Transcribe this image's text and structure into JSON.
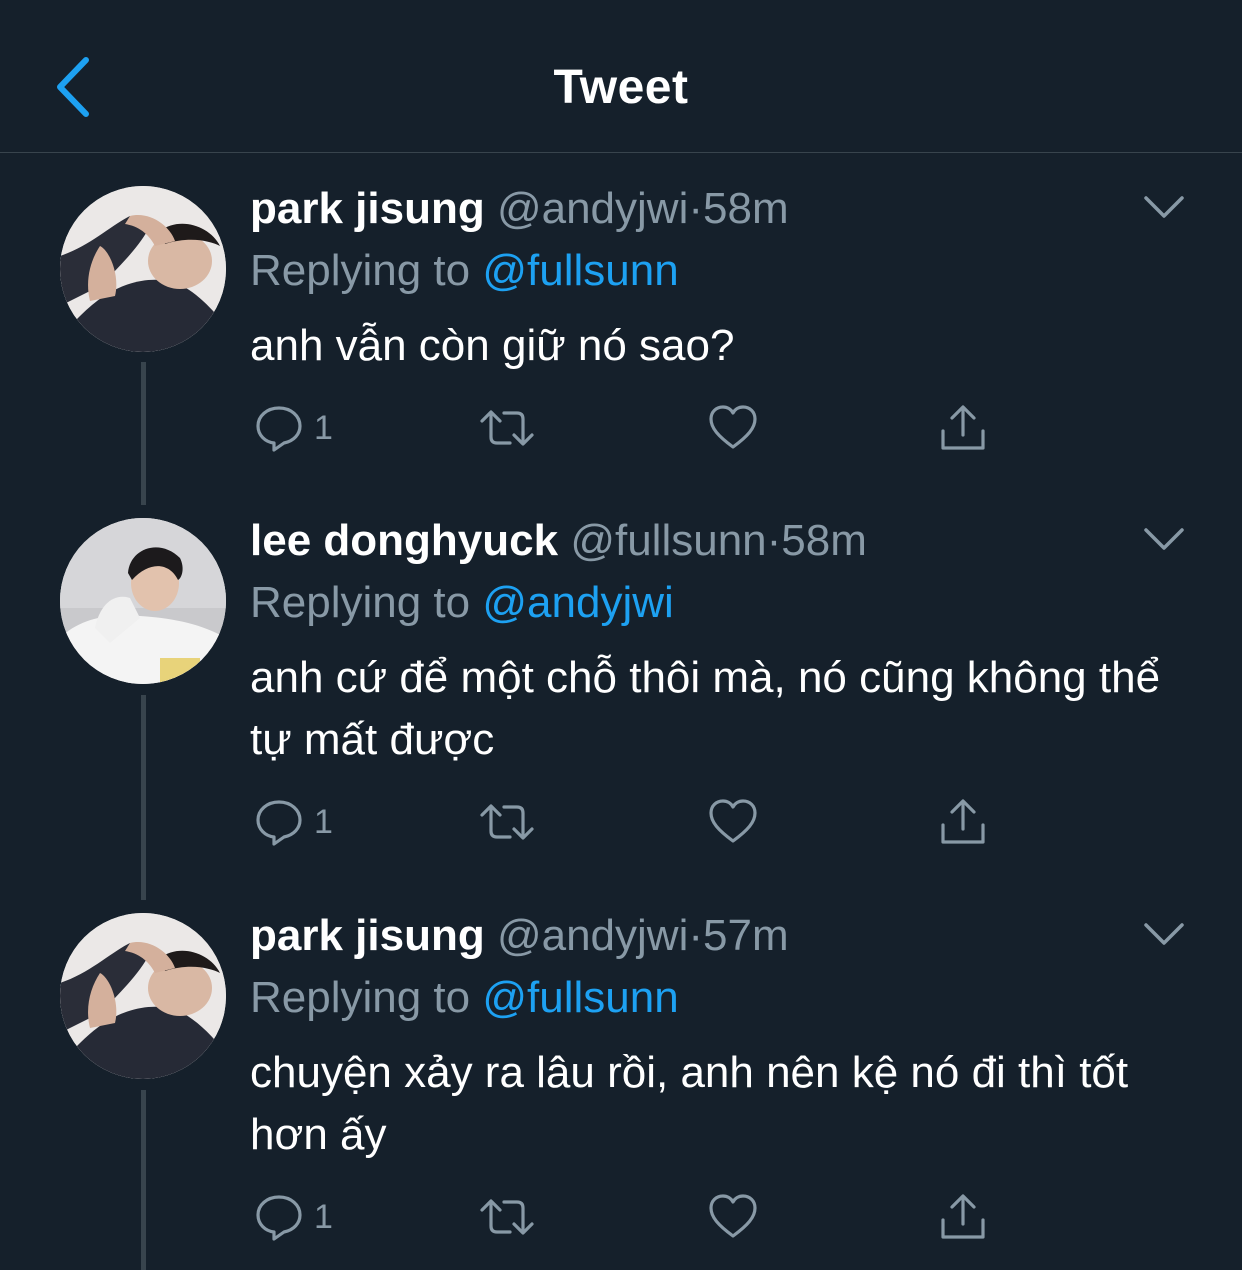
{
  "header": {
    "title": "Tweet",
    "back_icon": "chevron-left-icon",
    "accent_color": "#1da1f2"
  },
  "tweets": [
    {
      "name": "park jisung",
      "handle": "@andyjwi",
      "separator": "·",
      "time": "58m",
      "replying_prefix": "Replying to",
      "replying_to": "@fullsunn",
      "text": "anh vẫn còn giữ nó sao?",
      "reply_count": "1",
      "avatar": "avatar-photo"
    },
    {
      "name": "lee donghyuck",
      "handle": "@fullsunn",
      "separator": "·",
      "time": "58m",
      "replying_prefix": "Replying to",
      "replying_to": "@andyjwi",
      "text": "anh cứ để một chỗ thôi mà, nó cũng không thể tự mất được",
      "reply_count": "1",
      "avatar": "avatar-photo"
    },
    {
      "name": "park jisung",
      "handle": "@andyjwi",
      "separator": "·",
      "time": "57m",
      "replying_prefix": "Replying to",
      "replying_to": "@fullsunn",
      "text": "chuyện xảy ra lâu rồi, anh nên kệ nó đi thì tốt hơn ấy",
      "reply_count": "1",
      "avatar": "avatar-photo"
    }
  ],
  "icons": {
    "reply": "comment-icon",
    "retweet": "retweet-icon",
    "like": "heart-icon",
    "share": "share-icon",
    "more": "chevron-down-icon"
  },
  "colors": {
    "background": "#15202b",
    "secondary_text": "#8899a6",
    "mention": "#1da1f2",
    "divider": "#38444d"
  }
}
